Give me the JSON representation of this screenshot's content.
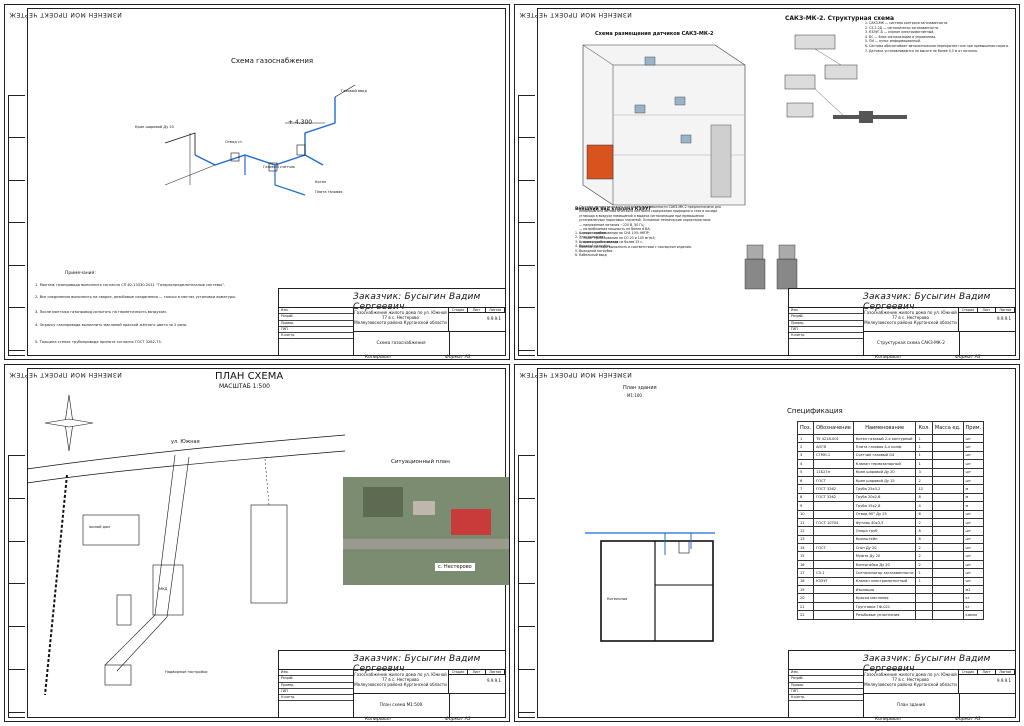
{
  "common": {
    "stamp_top": "ИЗМЕНЁН МОЙ ПРОЕКТ ЧЕРТЕЖ",
    "customer": "Заказчик: Бусыгин Вадим Сергеевич",
    "project": "Газоснабжение жилого дома по ул. Южной 77 в с. Нестерово",
    "region": "Мелеузовского района Курганской области",
    "code": "9.9.9.1",
    "copied": "Копировал",
    "format": "Формат  А3",
    "side_labels": [
      "Инв. № подл.",
      "Подп. и дата",
      "Взам. инв. №",
      "Согласовано"
    ],
    "tb_rows": [
      "Изм.",
      "Кол.уч",
      "Лист",
      "№ док.",
      "Подп.",
      "Дата",
      "Разраб.",
      "Провер.",
      "ГИП",
      "Н.контр."
    ],
    "tb_right_heads": [
      "Стадия",
      "Лист",
      "Листов"
    ],
    "tb_stage": "Р"
  },
  "sheet1": {
    "title": "Схема газоснабжения",
    "elevation": "+ 4.300",
    "labels": [
      "Газовый ввод",
      "Кран шаровой Ду 20",
      "Отвод ст.",
      "Газовый счетчик",
      "Котел",
      "Плита газовая"
    ],
    "notes_heading": "Примечания:",
    "notes": [
      "1. Монтаж газопровода выполнить согласно СП 62.13330.2011 \"Газораспределительные системы\".",
      "2. Все соединения выполнить на сварке, резьбовые соединения — только в местах установки арматуры.",
      "3. После монтажа газопровод испытать на герметичность воздухом.",
      "4. Окраску газопровода выполнить масляной краской жёлтого цвета за 2 раза.",
      "5. Толщина стенок трубопровода принята согласно ГОСТ 3262-75."
    ],
    "sheet_name": "Схема газоснабжения"
  },
  "sheet2": {
    "title_right": "САКЗ-МК-2. Структурная схема",
    "title_left": "Схема размещения датчиков САКЗ-МК-2",
    "title_valve": "Внешний вид клапана КЗЭУГ",
    "right_notes": [
      "1. САКЗ-МК — система контроля загазованности.",
      "2. СЗ-1-2Д — сигнализатор загазованности.",
      "3. КЗЭУГ-Б — клапан электромагнитный.",
      "4. БС — блок сигнализации и управления.",
      "5. ПИ — пульт информационный.",
      "6. Система обеспечивает автоматическое перекрытие газа при превышении порога.",
      "7. Датчики устанавливаются на высоте не более 0,5 м от потолка."
    ],
    "valve_legend": [
      "1. Корпус клапана",
      "2. Электромагнит",
      "3. Кнопка ручного взвода",
      "4. Входной патрубок",
      "5. Выходной патрубок",
      "6. Кабельный ввод"
    ],
    "body_text": [
      "Система автоматического контроля загазованности САКЗ-МК-2 предназначена для",
      "непрерывного автоматического контроля содержания природного газа и оксида",
      "углерода в воздухе помещений и выдачи сигнализации при превышении",
      "установленных пороговых значений. Основные технические характеристики:",
      "— напряжение питания ~220 В, 50 Гц;",
      "— потребляемая мощность не более 6 ВА;",
      "— порог срабатывания по СН4 10% НКПР;",
      "— порог срабатывания по СО 20 и 100 мг/м3;",
      "— время срабатывания не более 15 с.",
      "Монтаж системы выполнить в соответствии с паспортом изделия."
    ],
    "sheet_name": "Структурная схема САКЗ-МК-2"
  },
  "sheet3": {
    "title": "ПЛАН СХЕМА",
    "scale": "МАСШТАБ 1:500",
    "street": "ул. Южная",
    "sit_title": "Ситуационный план",
    "sit_label": "с. Нестерово",
    "bld_names": [
      "жилой дом",
      "Надворные постройки",
      "МКД"
    ],
    "sheet_name": "План схема М1:500"
  },
  "sheet4": {
    "title": "План здания",
    "scale": "М1:100",
    "spec_title": "Спецификация",
    "spec_heads": [
      "Поз.",
      "Обозначение",
      "Наименование",
      "Кол.",
      "Масса ед.",
      "Прим."
    ],
    "spec_rows": [
      [
        "1",
        "ТУ 4218-001",
        "Котел газовый 2-х контурный",
        "1",
        "",
        "шт"
      ],
      [
        "2",
        "АОГВ",
        "Плита газовая 4-х конф.",
        "1",
        "",
        "шт"
      ],
      [
        "3",
        "СГМН-1",
        "Счетчик газовый G4",
        "1",
        "",
        "шт"
      ],
      [
        "4",
        "",
        "Клапан термозапорный",
        "1",
        "",
        "шт"
      ],
      [
        "5",
        "11Б27п",
        "Кран шаровой Ду 20",
        "3",
        "",
        "шт"
      ],
      [
        "6",
        "ГОСТ",
        "Кран шаровой Ду 15",
        "2",
        "",
        "шт"
      ],
      [
        "7",
        "ГОСТ 3262",
        "Труба 25х3,2",
        "12",
        "",
        "м"
      ],
      [
        "8",
        "ГОСТ 3262",
        "Труба 20х2,8",
        "8",
        "",
        "м"
      ],
      [
        "9",
        "",
        "Труба 15х2,8",
        "4",
        "",
        "м"
      ],
      [
        "10",
        "",
        "Отвод 90° Ду 25",
        "6",
        "",
        "шт"
      ],
      [
        "11",
        "ГОСТ 10704",
        "Футляр 40х3,5",
        "2",
        "",
        "шт"
      ],
      [
        "12",
        "",
        "Опора труб",
        "8",
        "",
        "шт"
      ],
      [
        "13",
        "",
        "Кронштейн",
        "6",
        "",
        "шт"
      ],
      [
        "14",
        "ГОСТ",
        "Сгон Ду 20",
        "2",
        "",
        "шт"
      ],
      [
        "15",
        "",
        "Муфта Ду 20",
        "2",
        "",
        "шт"
      ],
      [
        "16",
        "",
        "Контргайка Ду 20",
        "2",
        "",
        "шт"
      ],
      [
        "17",
        "СЗ-1",
        "Сигнализатор загазованности",
        "1",
        "",
        "шт"
      ],
      [
        "18",
        "КЗЭУГ",
        "Клапан электромагнитный",
        "1",
        "",
        "шт"
      ],
      [
        "19",
        "",
        "Изоляция",
        "",
        "",
        "м2"
      ],
      [
        "20",
        "",
        "Краска масляная",
        "",
        "",
        "кг"
      ],
      [
        "21",
        "",
        "Грунтовка ГФ-021",
        "",
        "",
        "кг"
      ],
      [
        "22",
        "",
        "Резьбовые уплотнения",
        "",
        "",
        "компл"
      ]
    ],
    "room_label": "Котельная",
    "sheet_name": "План здания"
  }
}
